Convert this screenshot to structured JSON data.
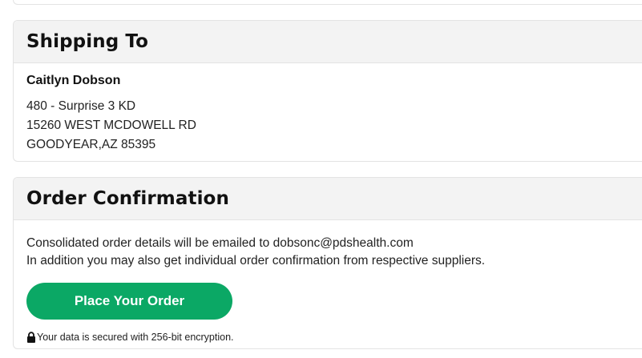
{
  "shipping": {
    "title": "Shipping To",
    "name": "Caitlyn Dobson",
    "address": [
      "480 - Surprise 3 KD",
      "15260 WEST MCDOWELL RD",
      "GOODYEAR,AZ 85395"
    ]
  },
  "confirmation": {
    "title": "Order Confirmation",
    "email_line": "Consolidated order details will be emailed to dobsonc@pdshealth.com",
    "supplier_line": "In addition you may also get individual order confirmation from respective suppliers.",
    "place_order_label": "Place Your Order",
    "secure_note": "Your data is secured with 256-bit encryption.",
    "secure_icon": "lock-icon"
  },
  "colors": {
    "primary_button": "#0ba865",
    "header_bg": "#f3f3f3",
    "border": "#e3e3e3"
  }
}
